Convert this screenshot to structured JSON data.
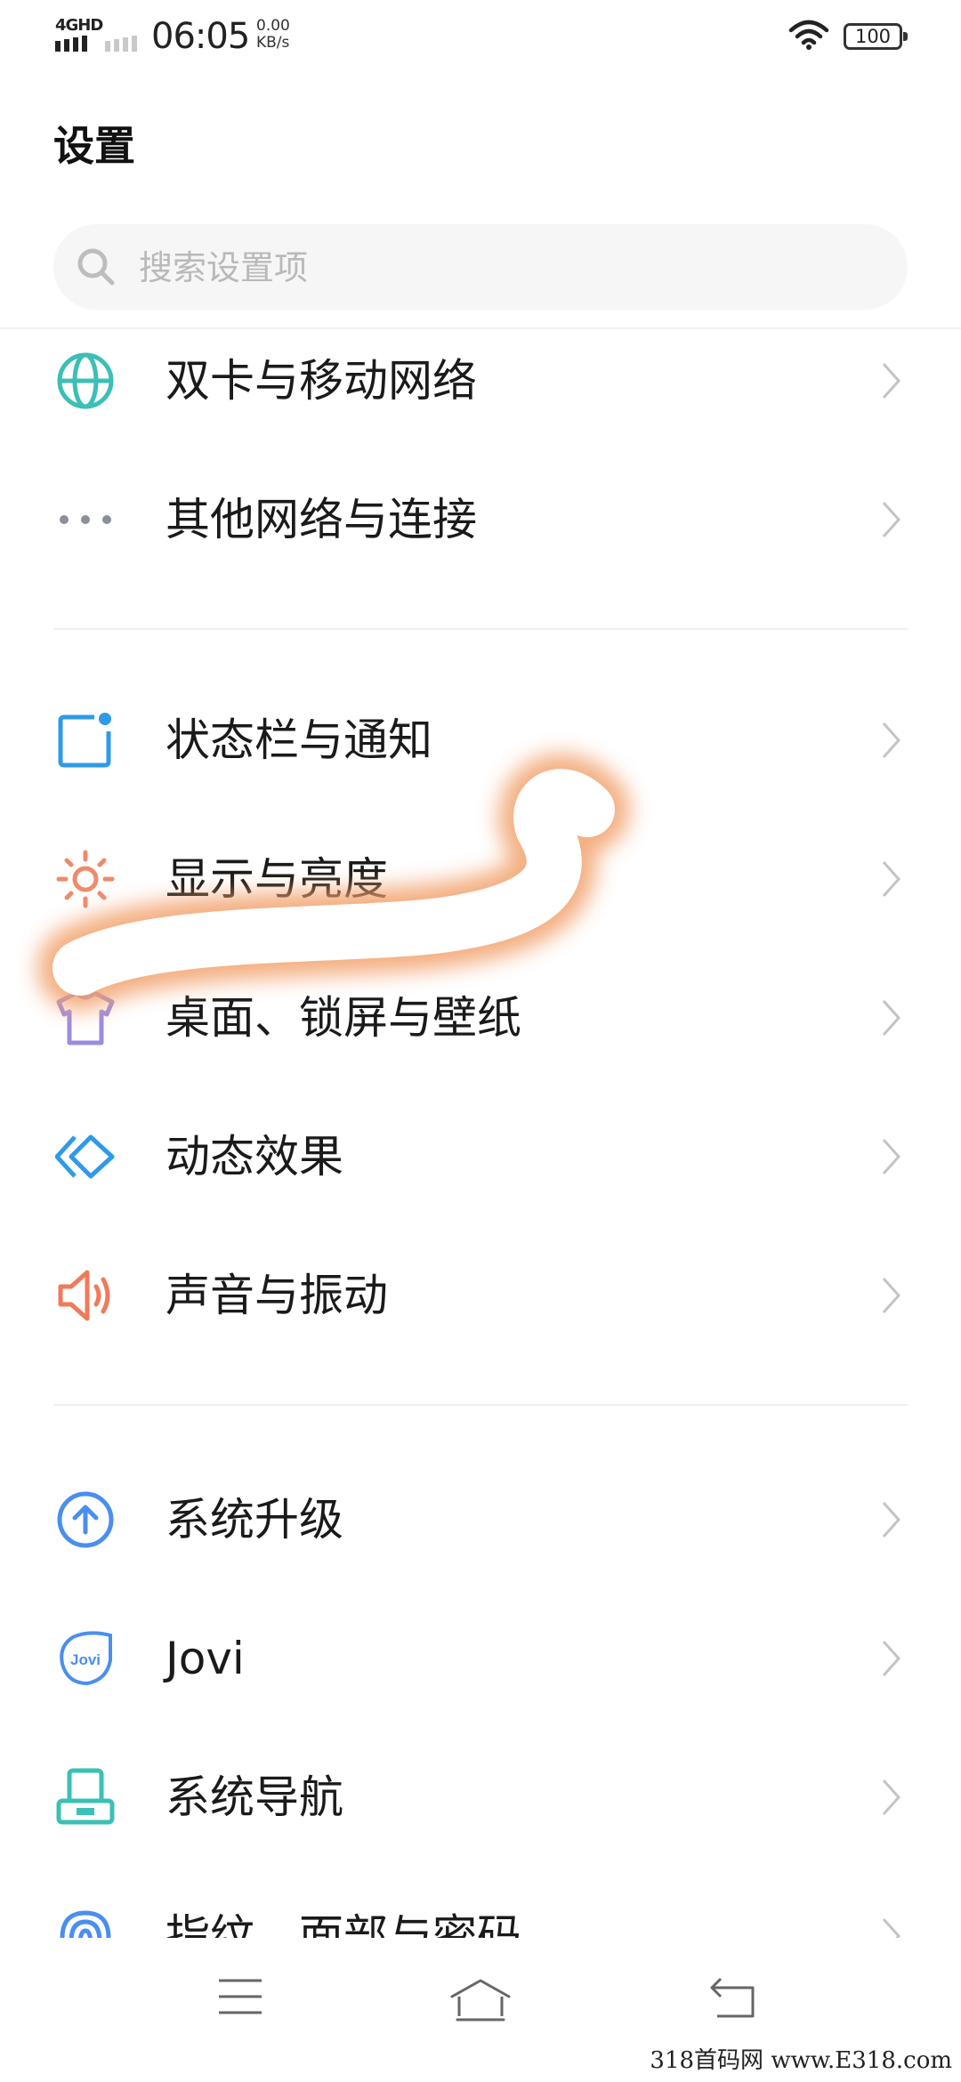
{
  "status_bar": {
    "network": "4GHD",
    "time": "06:05",
    "speed_value": "0.00",
    "speed_unit": "KB/s",
    "battery": "100"
  },
  "header": {
    "title": "设置",
    "search_placeholder": "搜索设置项"
  },
  "items": [
    {
      "label": "双卡与移动网络",
      "icon": "globe-icon",
      "color": "#3bbfb6"
    },
    {
      "label": "其他网络与连接",
      "icon": "more-dots-icon",
      "color": "#8a8f99"
    },
    {
      "label": "状态栏与通知",
      "icon": "status-bar-icon",
      "color": "#2f9ae8"
    },
    {
      "label": "显示与亮度",
      "icon": "sun-icon",
      "color": "#f08a6a"
    },
    {
      "label": "桌面、锁屏与壁纸",
      "icon": "tshirt-icon",
      "color": "#9b8ce0"
    },
    {
      "label": "动态效果",
      "icon": "diamond-icon",
      "color": "#2f9ae8"
    },
    {
      "label": "声音与振动",
      "icon": "speaker-icon",
      "color": "#f07a5a"
    },
    {
      "label": "系统升级",
      "icon": "upgrade-icon",
      "color": "#4a8ef0"
    },
    {
      "label": "Jovi",
      "icon": "jovi-icon",
      "color": "#4a8ef0"
    },
    {
      "label": "系统导航",
      "icon": "navigation-icon",
      "color": "#3bbfb6"
    },
    {
      "label": "指纹、面部与密码",
      "icon": "fingerprint-icon",
      "color": "#4a8ef0"
    }
  ],
  "nav": {
    "menu": "menu-icon",
    "home": "home-icon",
    "back": "back-icon"
  },
  "watermark": "318首码网 www.E318.com",
  "colors": {
    "highlight_stroke": "#f2a06a",
    "chevron": "#c4c4c4"
  }
}
